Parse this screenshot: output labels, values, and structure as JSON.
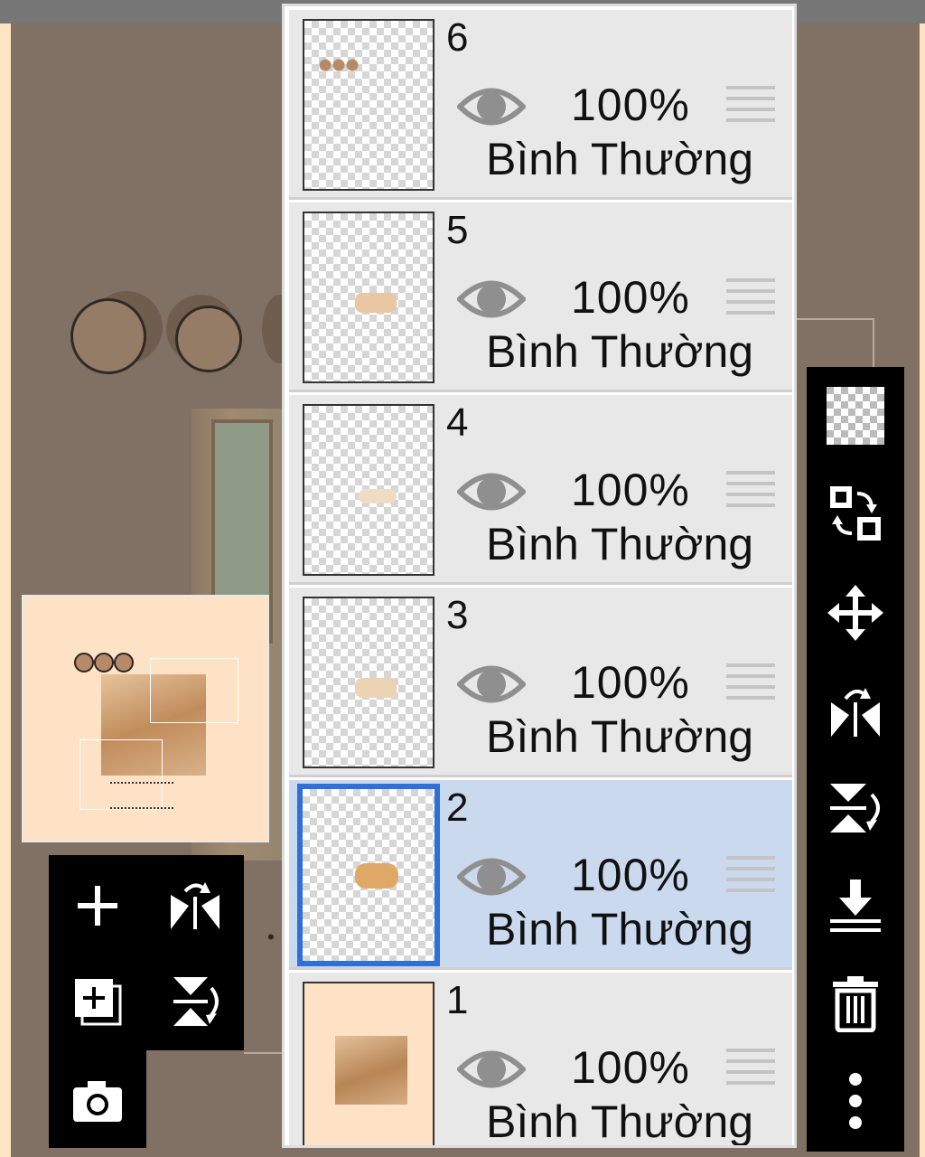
{
  "layers": [
    {
      "number": "6",
      "opacity": "100%",
      "blend": "Bình Thường"
    },
    {
      "number": "5",
      "opacity": "100%",
      "blend": "Bình Thường"
    },
    {
      "number": "4",
      "opacity": "100%",
      "blend": "Bình Thường"
    },
    {
      "number": "3",
      "opacity": "100%",
      "blend": "Bình Thường"
    },
    {
      "number": "2",
      "opacity": "100%",
      "blend": "Bình Thường",
      "selected": true
    },
    {
      "number": "1",
      "opacity": "100%",
      "blend": "Bình Thường"
    }
  ],
  "left_toolbar": {
    "icons": [
      "add-layer-icon",
      "flip-horizontal-icon",
      "duplicate-layer-icon",
      "flip-vertical-icon",
      "camera-icon"
    ]
  },
  "right_toolbar": {
    "icons": [
      "transparency-icon",
      "swap-icon",
      "move-icon",
      "flip-horizontal-icon",
      "flip-vertical-icon",
      "merge-down-icon",
      "trash-icon",
      "more-icon"
    ]
  },
  "colors": {
    "selected_row": "#cad9ee",
    "selected_border": "#2f6fd8",
    "canvas_bg": "#807164",
    "page_bg": "#ffe4c4"
  }
}
